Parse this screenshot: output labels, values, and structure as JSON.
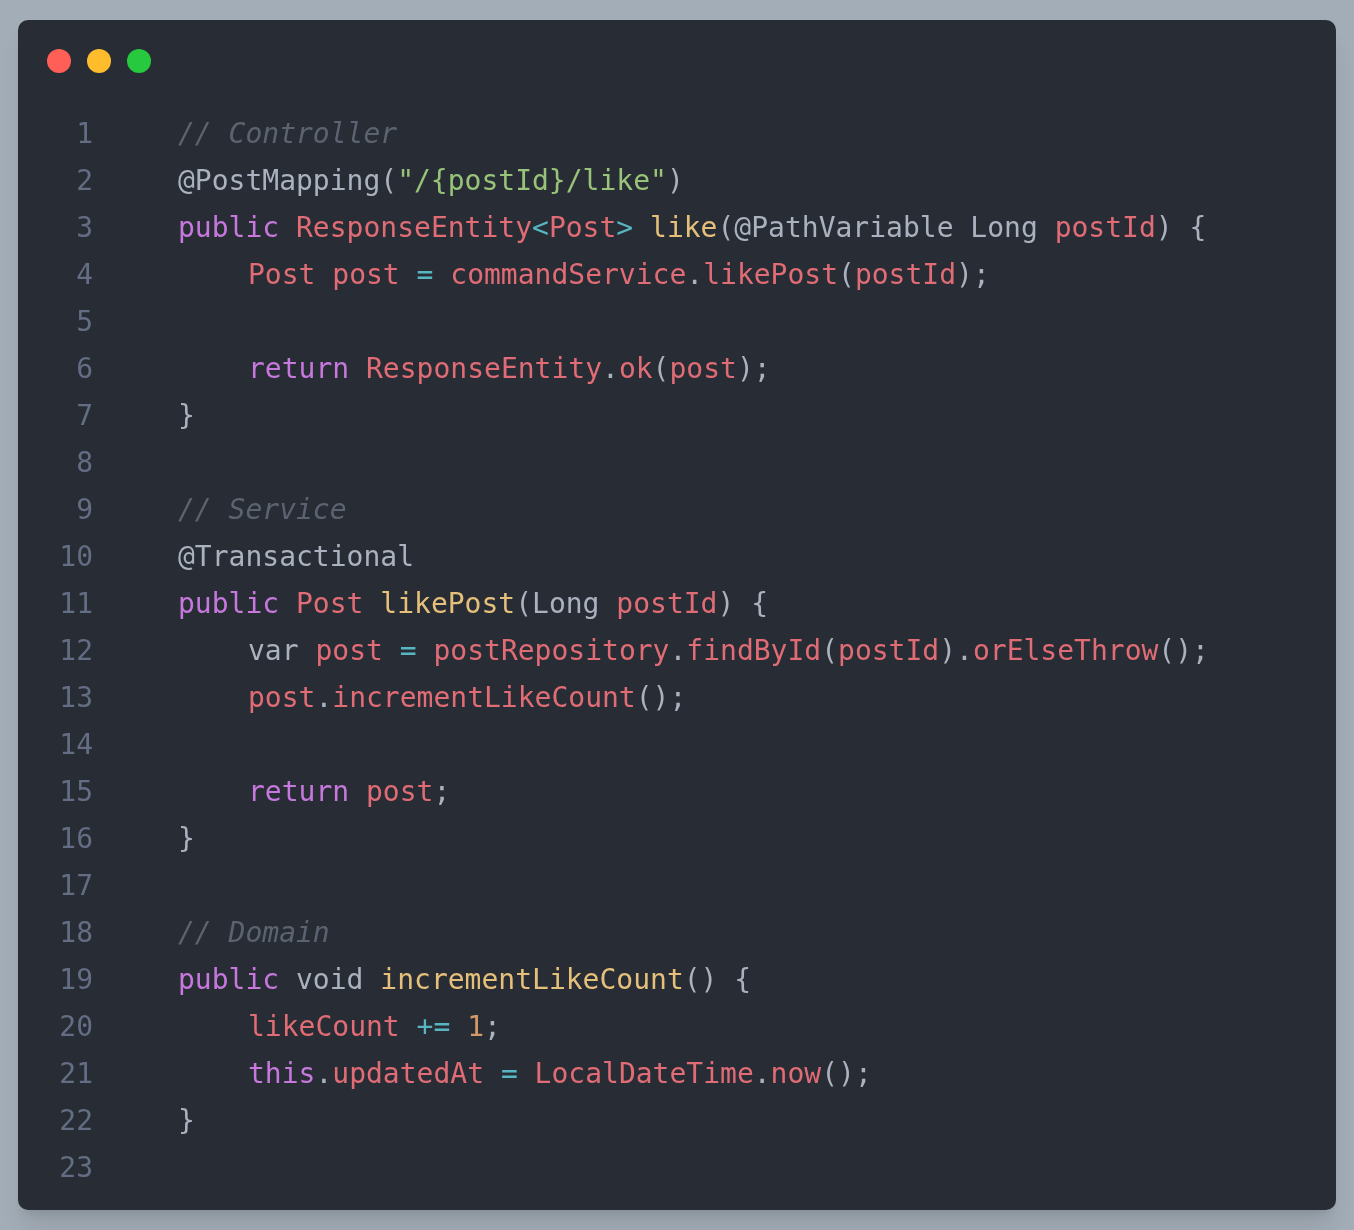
{
  "window": {
    "buttons": [
      {
        "kind": "close"
      },
      {
        "kind": "minimize"
      },
      {
        "kind": "zoom"
      }
    ]
  },
  "code": {
    "lines": [
      {
        "number": "1",
        "tokens": [
          {
            "text": "// Controller",
            "kind": "comment"
          }
        ]
      },
      {
        "number": "2",
        "tokens": [
          {
            "text": "@PostMapping(",
            "kind": "plain"
          },
          {
            "text": "\"/{postId}/like\"",
            "kind": "string"
          },
          {
            "text": ")",
            "kind": "plain"
          }
        ]
      },
      {
        "number": "3",
        "tokens": [
          {
            "text": "public ",
            "kind": "keyword"
          },
          {
            "text": "ResponseEntity",
            "kind": "variable"
          },
          {
            "text": "<",
            "kind": "operator"
          },
          {
            "text": "Post",
            "kind": "variable"
          },
          {
            "text": "> ",
            "kind": "operator"
          },
          {
            "text": "like",
            "kind": "function"
          },
          {
            "text": "(@PathVariable Long ",
            "kind": "plain"
          },
          {
            "text": "postId",
            "kind": "variable"
          },
          {
            "text": ") {",
            "kind": "plain"
          }
        ],
        "children": [
          {
            "number": "4",
            "tokens": [
              {
                "text": "Post post ",
                "kind": "variable"
              },
              {
                "text": "= ",
                "kind": "operator"
              },
              {
                "text": "commandService",
                "kind": "variable"
              },
              {
                "text": ".",
                "kind": "plain"
              },
              {
                "text": "likePost",
                "kind": "variable"
              },
              {
                "text": "(",
                "kind": "plain"
              },
              {
                "text": "postId",
                "kind": "variable"
              },
              {
                "text": ");",
                "kind": "plain"
              }
            ]
          },
          {
            "number": "5"
          },
          {
            "number": "6",
            "tokens": [
              {
                "text": "return ",
                "kind": "keyword"
              },
              {
                "text": "ResponseEntity",
                "kind": "variable"
              },
              {
                "text": ".",
                "kind": "plain"
              },
              {
                "text": "ok",
                "kind": "variable"
              },
              {
                "text": "(",
                "kind": "plain"
              },
              {
                "text": "post",
                "kind": "variable"
              },
              {
                "text": ");",
                "kind": "plain"
              }
            ]
          }
        ]
      },
      {
        "number": "7",
        "tokens": [
          {
            "text": "}",
            "kind": "plain"
          }
        ]
      },
      {
        "number": "8"
      },
      {
        "number": "9",
        "tokens": [
          {
            "text": "// Service",
            "kind": "comment"
          }
        ]
      },
      {
        "number": "10",
        "tokens": [
          {
            "text": "@Transactional",
            "kind": "plain"
          }
        ]
      },
      {
        "number": "11",
        "tokens": [
          {
            "text": "public ",
            "kind": "keyword"
          },
          {
            "text": "Post ",
            "kind": "variable"
          },
          {
            "text": "likePost",
            "kind": "function"
          },
          {
            "text": "(Long ",
            "kind": "plain"
          },
          {
            "text": "postId",
            "kind": "variable"
          },
          {
            "text": ") {",
            "kind": "plain"
          }
        ],
        "children": [
          {
            "number": "12",
            "tokens": [
              {
                "text": "var ",
                "kind": "plain"
              },
              {
                "text": "post ",
                "kind": "variable"
              },
              {
                "text": "= ",
                "kind": "operator"
              },
              {
                "text": "postRepository",
                "kind": "variable"
              },
              {
                "text": ".",
                "kind": "plain"
              },
              {
                "text": "findById",
                "kind": "variable"
              },
              {
                "text": "(",
                "kind": "plain"
              },
              {
                "text": "postId",
                "kind": "variable"
              },
              {
                "text": ").",
                "kind": "plain"
              },
              {
                "text": "orElseThrow",
                "kind": "variable"
              },
              {
                "text": "();",
                "kind": "plain"
              }
            ]
          },
          {
            "number": "13",
            "tokens": [
              {
                "text": "post",
                "kind": "variable"
              },
              {
                "text": ".",
                "kind": "plain"
              },
              {
                "text": "incrementLikeCount",
                "kind": "variable"
              },
              {
                "text": "();",
                "kind": "plain"
              }
            ]
          },
          {
            "number": "14"
          },
          {
            "number": "15",
            "tokens": [
              {
                "text": "return ",
                "kind": "keyword"
              },
              {
                "text": "post",
                "kind": "variable"
              },
              {
                "text": ";",
                "kind": "plain"
              }
            ]
          }
        ]
      },
      {
        "number": "16",
        "tokens": [
          {
            "text": "}",
            "kind": "plain"
          }
        ]
      },
      {
        "number": "17"
      },
      {
        "number": "18",
        "tokens": [
          {
            "text": "// Domain",
            "kind": "comment"
          }
        ]
      },
      {
        "number": "19",
        "tokens": [
          {
            "text": "public ",
            "kind": "keyword"
          },
          {
            "text": "void ",
            "kind": "plain"
          },
          {
            "text": "incrementLikeCount",
            "kind": "function"
          },
          {
            "text": "() {",
            "kind": "plain"
          }
        ],
        "children": [
          {
            "number": "20",
            "tokens": [
              {
                "text": "likeCount ",
                "kind": "variable"
              },
              {
                "text": "+= ",
                "kind": "operator"
              },
              {
                "text": "1",
                "kind": "number"
              },
              {
                "text": ";",
                "kind": "plain"
              }
            ]
          },
          {
            "number": "21",
            "tokens": [
              {
                "text": "this",
                "kind": "keyword"
              },
              {
                "text": ".",
                "kind": "plain"
              },
              {
                "text": "updatedAt ",
                "kind": "variable"
              },
              {
                "text": "= ",
                "kind": "operator"
              },
              {
                "text": "LocalDateTime",
                "kind": "variable"
              },
              {
                "text": ".",
                "kind": "plain"
              },
              {
                "text": "now",
                "kind": "variable"
              },
              {
                "text": "();",
                "kind": "plain"
              }
            ]
          }
        ]
      },
      {
        "number": "22",
        "tokens": [
          {
            "text": "}",
            "kind": "plain"
          }
        ]
      },
      {
        "number": "23"
      }
    ]
  }
}
